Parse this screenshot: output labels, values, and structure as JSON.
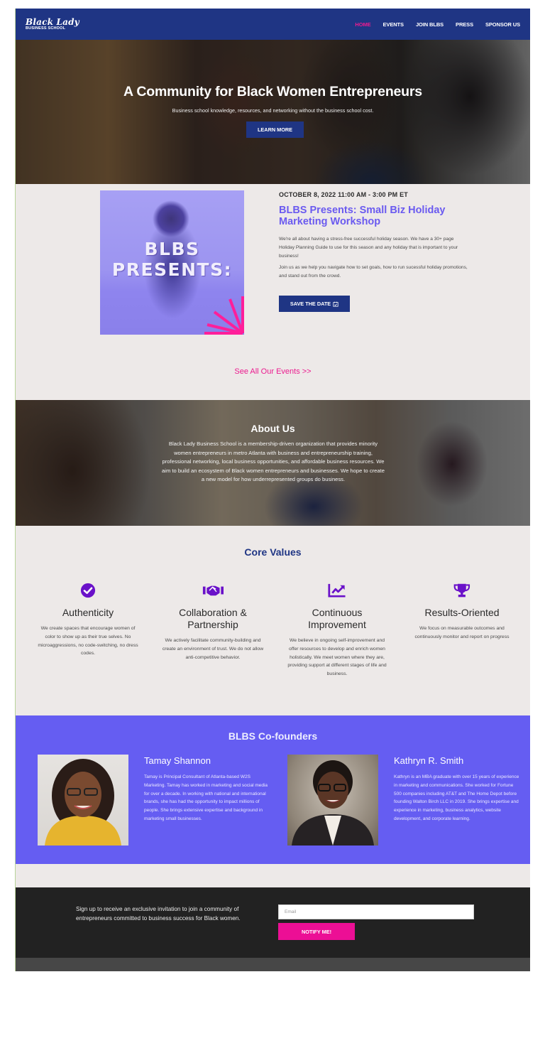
{
  "brand": {
    "logo_script": "Black Lady",
    "logo_sub": "BUSINESS SCHOOL",
    "colors": {
      "navy": "#1f3584",
      "pink": "#ec1b8f",
      "purple": "#655df2",
      "icon_purple": "#6a11c9",
      "light_bg": "#ede9e8",
      "dark_bg": "#222222"
    }
  },
  "nav": {
    "items": [
      {
        "label": "HOME",
        "active": true
      },
      {
        "label": "EVENTS",
        "active": false
      },
      {
        "label": "JOIN BLBS",
        "active": false
      },
      {
        "label": "PRESS",
        "active": false
      },
      {
        "label": "SPONSOR US",
        "active": false
      }
    ]
  },
  "hero": {
    "title": "A Community for Black Women Entrepreneurs",
    "subtitle": "Business school knowledge, resources, and networking without the business school cost.",
    "button_label": "LEARN MORE"
  },
  "event": {
    "image_text_line1": "BLBS",
    "image_text_line2": "PRESENTS:",
    "date": "OCTOBER 8, 2022 11:00 AM - 3:00 PM ET",
    "title": "BLBS Presents: Small Biz Holiday Marketing Workshop",
    "paragraph1": "We're all about having a stress-free successful holiday season. We have a 30+ page Holiday Planning Guide to use for this season and any holiday that is important to your business!",
    "paragraph2": "Join us as we help you navigate how to set goals, how to run sucessful holiday promotions, and stand out from the crowd.",
    "button_label": "SAVE THE DATE",
    "button_icon": "calendar-check-icon",
    "all_events_link": "See All Our Events >>"
  },
  "about": {
    "title": "About Us",
    "text": "Black Lady Business School is a membership-driven organization that provides minority women entrepreneurs in metro Atlanta with business and entrepreneurship training, professional networking, local business opportunities, and affordable business resources. We aim to build an ecosystem of Black women entrepreneurs and businesses. We hope to create a new model for how underrepresented groups do business."
  },
  "values": {
    "title": "Core Values",
    "items": [
      {
        "icon": "check-circle-icon",
        "name": "Authenticity",
        "desc": "We create spaces that encourage women of color to show up as their true selves. No microaggressions, no code-switching, no dress codes."
      },
      {
        "icon": "handshake-icon",
        "name": "Collaboration & Partnership",
        "desc": "We actively facilitate community-building and create an environment of trust. We do not allow anti-competitive behavior."
      },
      {
        "icon": "chart-line-icon",
        "name": "Continuous Improvement",
        "desc": "We believe in ongoing self-improvement and offer resources to develop and enrich women holistically. We meet women where they are, providing support at different stages of life and business."
      },
      {
        "icon": "trophy-icon",
        "name": "Results-Oriented",
        "desc": "We focus on measurable outcomes and continuously monitor and report on progress"
      }
    ]
  },
  "founders": {
    "title": "BLBS Co-founders",
    "people": [
      {
        "name": "Tamay Shannon",
        "bio": "Tamay is Principal Consultant of Atlanta-based W2S Marketing. Tamay has worked in marketing and social media for over a decade. In working with national and international brands, she has had the opportunity to impact millions of people. She brings extensive expertise and background in marketing small businesses."
      },
      {
        "name": "Kathryn R. Smith",
        "bio": "Kathryn is an MBA graduate with over 15 years of experience in marketing and communications. She worked for Fortune 500 companies including AT&T and The Home Depot before founding Walton Birch LLC in 2019. She brings expertise and experience in marketing, business analytics, website development, and corporate learning."
      }
    ]
  },
  "signup": {
    "text": "Sign up to receive an exclusive invitation to join a community of entrepreneurs committed to business success for Black women.",
    "email_placeholder": "Email",
    "email_value": "",
    "button_label": "NOTIFY ME!"
  }
}
